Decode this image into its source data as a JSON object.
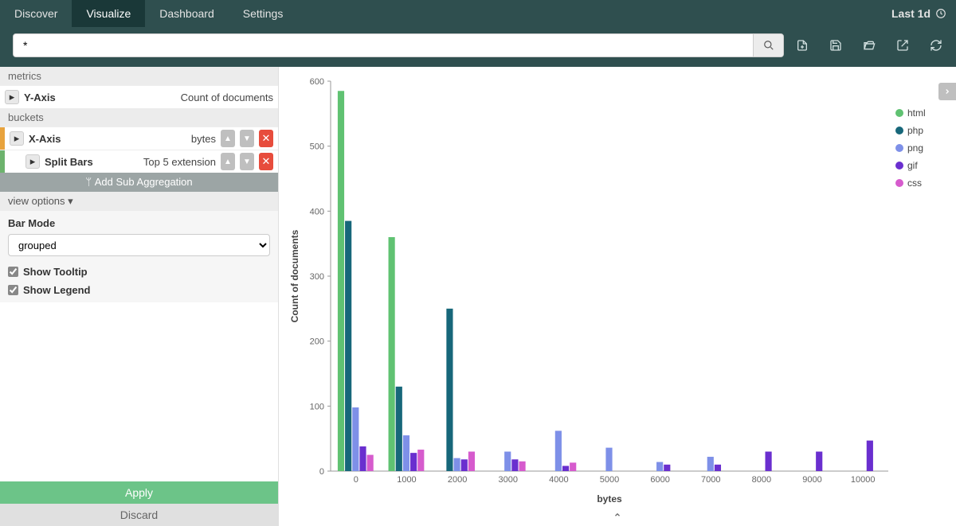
{
  "nav": {
    "items": [
      "Discover",
      "Visualize",
      "Dashboard",
      "Settings"
    ],
    "active_index": 1,
    "time_label": "Last 1d"
  },
  "search": {
    "value": "*"
  },
  "sidebar": {
    "metrics_header": "metrics",
    "yaxis_label": "Y-Axis",
    "yaxis_value": "Count of documents",
    "buckets_header": "buckets",
    "xaxis_label": "X-Axis",
    "xaxis_value": "bytes",
    "split_label": "Split Bars",
    "split_value": "Top 5 extension",
    "add_sub_label": "Add Sub Aggregation",
    "view_options_label": "view options ▾",
    "bar_mode_label": "Bar Mode",
    "bar_mode_value": "grouped",
    "show_tooltip_label": "Show Tooltip",
    "show_legend_label": "Show Legend",
    "apply_label": "Apply",
    "discard_label": "Discard"
  },
  "chart_data": {
    "type": "bar",
    "title": "",
    "xlabel": "bytes",
    "ylabel": "Count of documents",
    "ylim": [
      0,
      600
    ],
    "yticks": [
      0,
      100,
      200,
      300,
      400,
      500,
      600
    ],
    "categories": [
      0,
      1000,
      2000,
      3000,
      4000,
      5000,
      6000,
      7000,
      8000,
      9000,
      10000
    ],
    "series": [
      {
        "name": "html",
        "color": "#60c272",
        "values": [
          585,
          360,
          0,
          0,
          0,
          0,
          0,
          0,
          0,
          0,
          0
        ]
      },
      {
        "name": "php",
        "color": "#17677a",
        "values": [
          385,
          130,
          250,
          0,
          0,
          0,
          0,
          0,
          0,
          0,
          0
        ]
      },
      {
        "name": "png",
        "color": "#7e90e8",
        "values": [
          98,
          55,
          20,
          30,
          62,
          36,
          14,
          22,
          0,
          0,
          0
        ]
      },
      {
        "name": "gif",
        "color": "#6a2fcf",
        "values": [
          38,
          28,
          18,
          18,
          8,
          0,
          10,
          10,
          30,
          30,
          47
        ]
      },
      {
        "name": "css",
        "color": "#d65bcd",
        "values": [
          25,
          33,
          30,
          15,
          13,
          0,
          0,
          0,
          0,
          0,
          0
        ]
      }
    ],
    "legend_position": "right"
  }
}
